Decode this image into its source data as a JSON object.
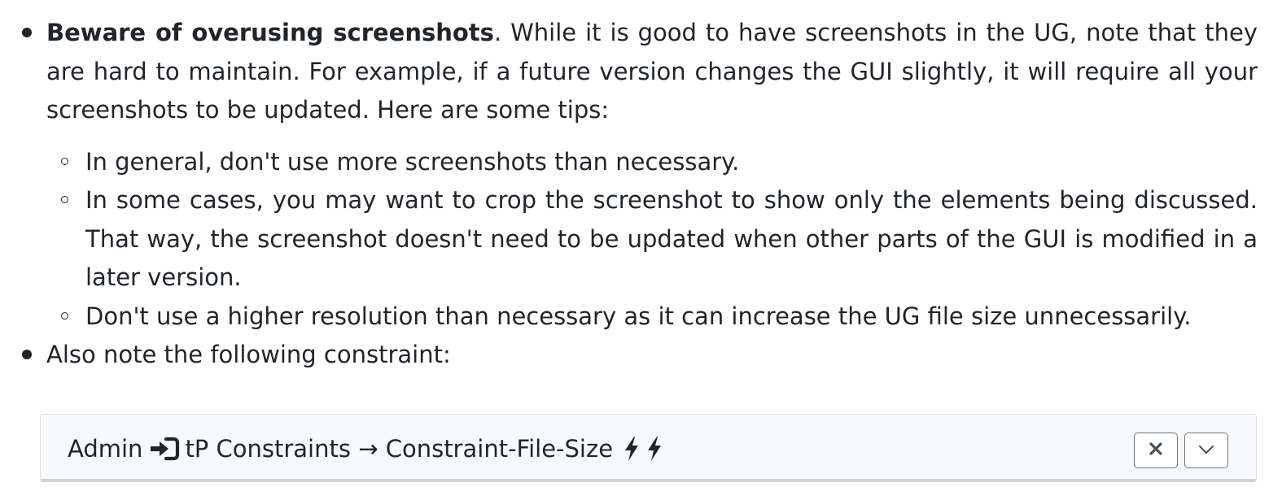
{
  "list": {
    "item1": {
      "bold": "Beware of overusing screenshots",
      "text": ". While it is good to have screenshots in the UG, note that they are hard to maintain. For example, if a future version changes the GUI slightly, it will require all your screenshots to be updated. Here are some tips:",
      "subitems": [
        "In general, don't use more screenshots than necessary.",
        "In some cases, you may want to crop the screenshot to show only the elements being discussed. That way, the screenshot doesn't need to be updated when other parts of the GUI is modified in a later version.",
        "Don't use a higher resolution than necessary as it can increase the UG file size unnecessarily."
      ]
    },
    "item2": {
      "text": "Also note the following constraint:"
    }
  },
  "panel": {
    "prefix": "Admin",
    "title": "tP Constraints → Constraint-File-Size",
    "icons": [
      "login-icon",
      "bolt-icon",
      "bolt-icon"
    ],
    "buttons": {
      "close_icon": "close-icon",
      "toggle_icon": "chevron-down-icon"
    }
  }
}
